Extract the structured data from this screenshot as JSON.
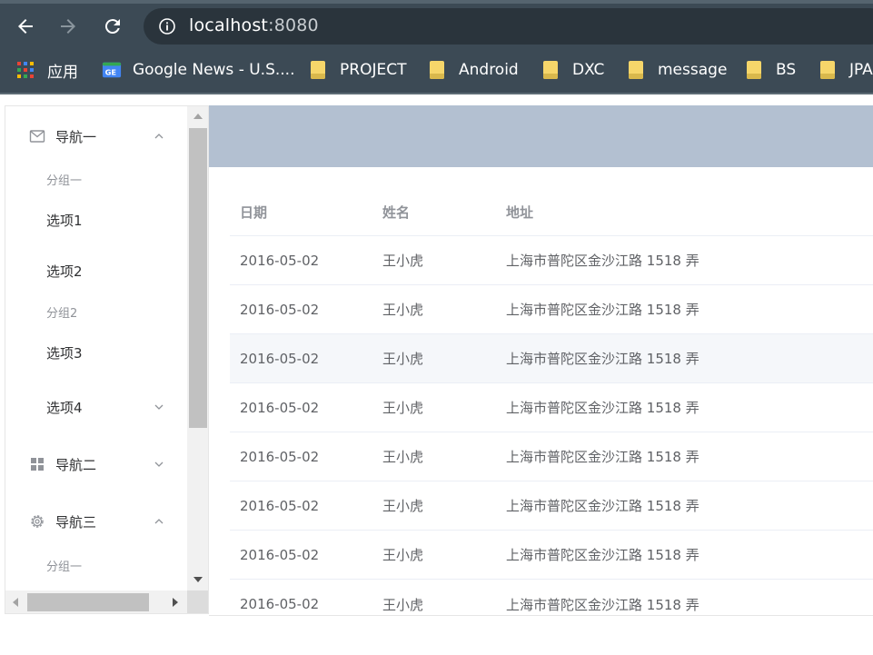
{
  "browser": {
    "url_host": "localhost",
    "url_port": ":8080",
    "bookmarks": [
      {
        "label": "应用",
        "icon": "apps-grid-icon"
      },
      {
        "label": "Google News - U.S....",
        "icon": "google-news-icon"
      },
      {
        "label": "PROJECT",
        "icon": "folder-icon"
      },
      {
        "label": "Android",
        "icon": "folder-icon"
      },
      {
        "label": "DXC",
        "icon": "folder-icon"
      },
      {
        "label": "message",
        "icon": "folder-icon"
      },
      {
        "label": "BS",
        "icon": "folder-icon"
      },
      {
        "label": "JPA",
        "icon": "folder-icon"
      }
    ]
  },
  "sidebar": {
    "nav1": {
      "label": "导航一",
      "icon": "message-icon",
      "expanded": true
    },
    "nav1_group1": "分组一",
    "nav1_option1": "选项1",
    "nav1_option2": "选项2",
    "nav1_group2": "分组2",
    "nav1_option3": "选项3",
    "nav1_option4": "选项4",
    "nav2": {
      "label": "导航二",
      "icon": "menu-grid-icon",
      "expanded": false
    },
    "nav3": {
      "label": "导航三",
      "icon": "setting-icon",
      "expanded": true
    },
    "nav3_group1": "分组一"
  },
  "table": {
    "headers": {
      "date": "日期",
      "name": "姓名",
      "address": "地址"
    },
    "rows": [
      {
        "date": "2016-05-02",
        "name": "王小虎",
        "address": "上海市普陀区金沙江路 1518 弄"
      },
      {
        "date": "2016-05-02",
        "name": "王小虎",
        "address": "上海市普陀区金沙江路 1518 弄"
      },
      {
        "date": "2016-05-02",
        "name": "王小虎",
        "address": "上海市普陀区金沙江路 1518 弄"
      },
      {
        "date": "2016-05-02",
        "name": "王小虎",
        "address": "上海市普陀区金沙江路 1518 弄"
      },
      {
        "date": "2016-05-02",
        "name": "王小虎",
        "address": "上海市普陀区金沙江路 1518 弄"
      },
      {
        "date": "2016-05-02",
        "name": "王小虎",
        "address": "上海市普陀区金沙江路 1518 弄"
      },
      {
        "date": "2016-05-02",
        "name": "王小虎",
        "address": "上海市普陀区金沙江路 1518 弄"
      },
      {
        "date": "2016-05-02",
        "name": "王小虎",
        "address": "上海市普陀区金沙江路 1518 弄"
      }
    ]
  },
  "colors": {
    "header_bg": "#b3c0d1",
    "chrome_bg": "#3c4a55",
    "row_hover": "#f5f7fa"
  }
}
